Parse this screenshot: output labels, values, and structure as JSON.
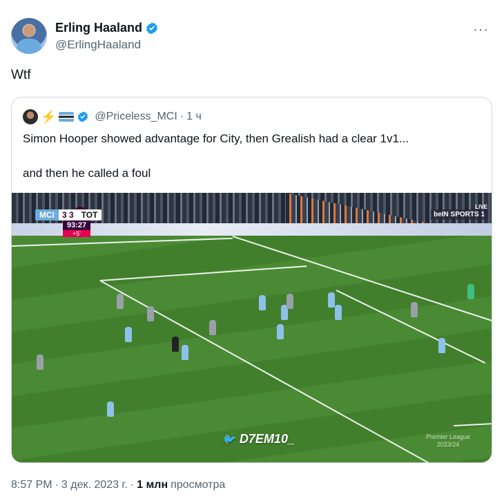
{
  "author": {
    "display_name": "Erling Haaland",
    "handle": "@ErlingHaaland",
    "verified": true
  },
  "tweet_text": "Wtf",
  "more_icon": "more-horizontal-icon",
  "quote": {
    "handle": "@Priceless_MCI",
    "separator": "·",
    "time": "1 ч",
    "text_line1": "Simon Hooper showed advantage for City, then Grealish had a clear 1v1...",
    "text_line2": "and then he called a foul",
    "media": {
      "scorebug": {
        "home": "MCI",
        "score": "3 3",
        "away": "TOT",
        "clock": "93:27",
        "added": "+5'"
      },
      "broadcaster": "beIN SPORTS 1",
      "live_label": "LIVE",
      "watermark": "D7EM10_",
      "league_mark_line1": "Premier League",
      "league_mark_line2": "2023/24"
    }
  },
  "footer": {
    "time": "8:57 PM",
    "separator1": "·",
    "date": "3 дек. 2023 г.",
    "separator2": "·",
    "views_count": "1 млн",
    "views_label": "просмотра"
  },
  "colors": {
    "verified_blue": "#1d9bf0",
    "text_primary": "#0f1419",
    "text_secondary": "#536471",
    "border": "#cfd9de"
  }
}
